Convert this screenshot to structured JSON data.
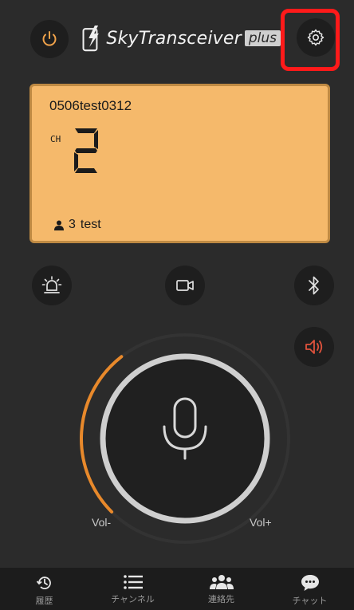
{
  "header": {
    "logo_text": "SkyTransceiver",
    "logo_badge": "plus",
    "icons": {
      "power": "power-icon",
      "logo": "phone-lightning-icon",
      "settings": "gear-icon"
    }
  },
  "lcd": {
    "group_name": "0506test0312",
    "channel_label": "CH",
    "channel_number": "2",
    "user_count": "3",
    "user_name": "test",
    "background_color": "#f5b96b"
  },
  "controls": {
    "alarm": "siren-icon",
    "camera": "video-camera-icon",
    "bluetooth": "bluetooth-icon",
    "speaker": "speaker-icon",
    "speaker_color": "#e0523c"
  },
  "ptt": {
    "icon": "microphone-icon",
    "volume_min_label": "Vol-",
    "volume_max_label": "Vol+",
    "volume_level": 0.12,
    "accent_color": "#e8892b"
  },
  "bottom_nav": {
    "items": [
      {
        "label": "履歴",
        "icon": "history-icon"
      },
      {
        "label": "チャンネル",
        "icon": "list-icon"
      },
      {
        "label": "連絡先",
        "icon": "contacts-icon"
      },
      {
        "label": "チャット",
        "icon": "chat-icon"
      }
    ]
  }
}
